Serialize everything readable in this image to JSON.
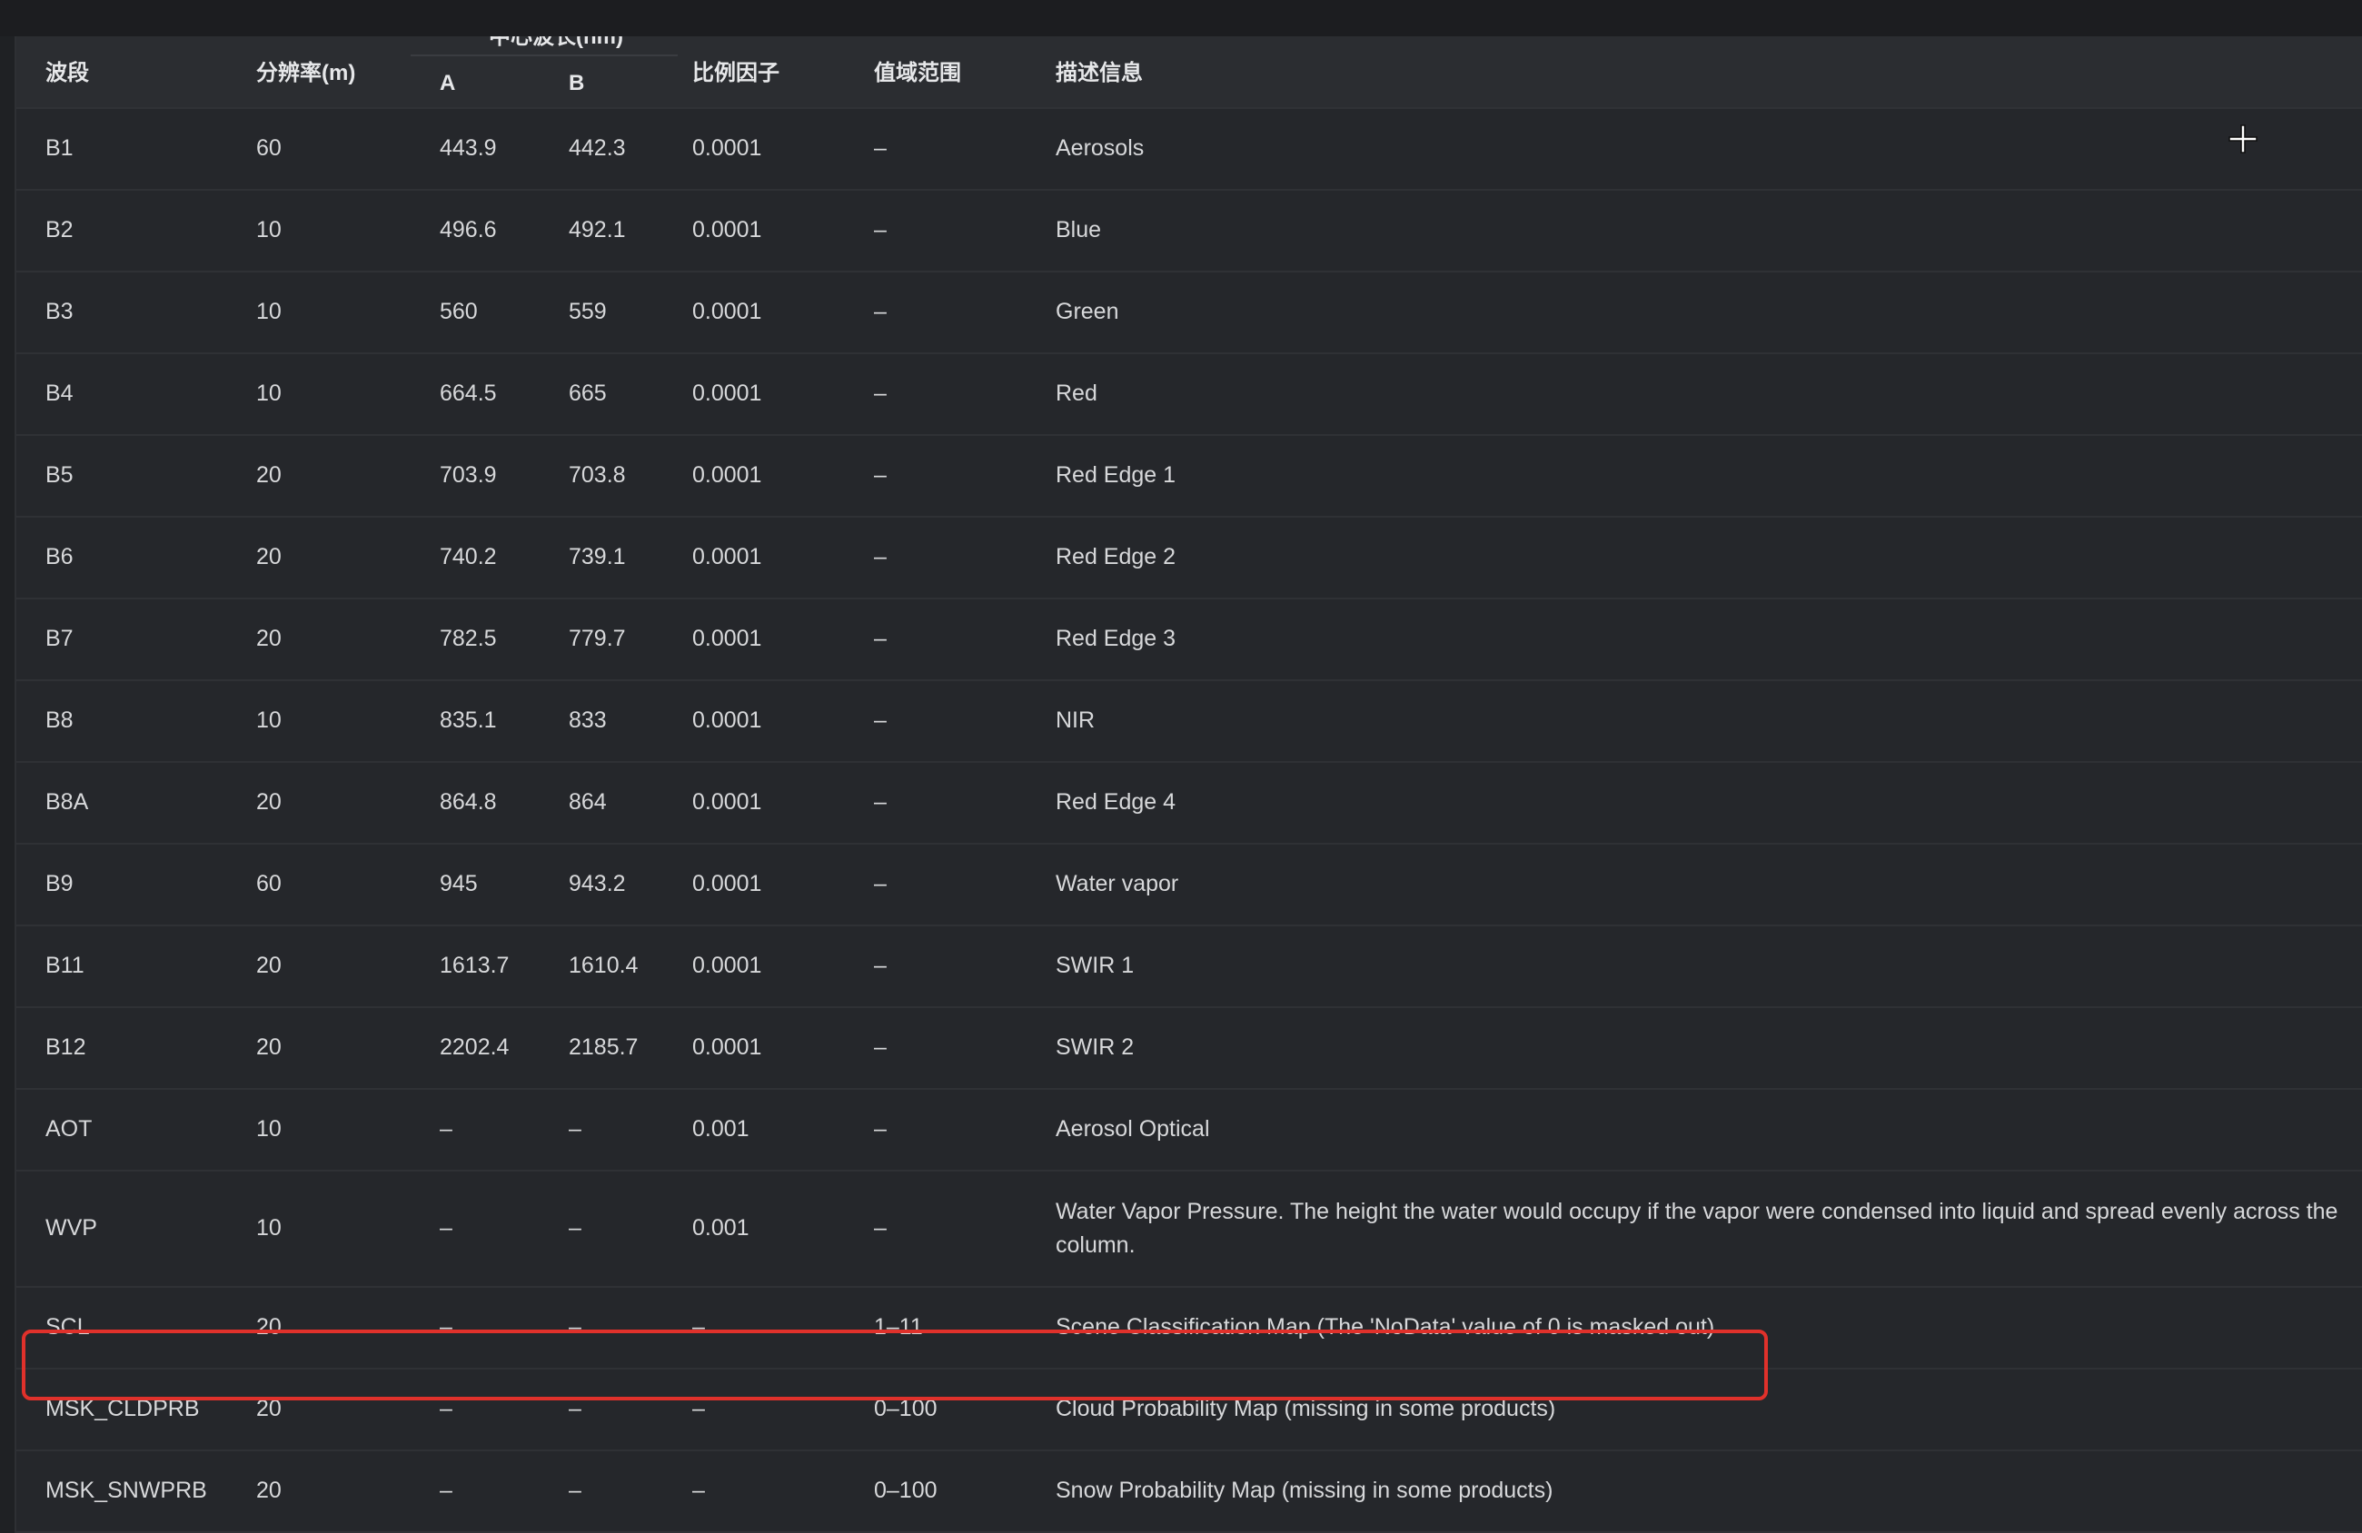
{
  "table": {
    "headers": {
      "band": "波段",
      "resolution": "分辨率(m)",
      "wavelength_group": "中心波长(nm)",
      "wavelength_a": "A",
      "wavelength_b": "B",
      "scale": "比例因子",
      "range": "值域范围",
      "description": "描述信息"
    },
    "rows": [
      {
        "band": "B1",
        "res": "60",
        "a": "443.9",
        "b": "442.3",
        "scale": "0.0001",
        "range": "–",
        "desc": "Aerosols"
      },
      {
        "band": "B2",
        "res": "10",
        "a": "496.6",
        "b": "492.1",
        "scale": "0.0001",
        "range": "–",
        "desc": "Blue"
      },
      {
        "band": "B3",
        "res": "10",
        "a": "560",
        "b": "559",
        "scale": "0.0001",
        "range": "–",
        "desc": "Green"
      },
      {
        "band": "B4",
        "res": "10",
        "a": "664.5",
        "b": "665",
        "scale": "0.0001",
        "range": "–",
        "desc": "Red"
      },
      {
        "band": "B5",
        "res": "20",
        "a": "703.9",
        "b": "703.8",
        "scale": "0.0001",
        "range": "–",
        "desc": "Red Edge 1"
      },
      {
        "band": "B6",
        "res": "20",
        "a": "740.2",
        "b": "739.1",
        "scale": "0.0001",
        "range": "–",
        "desc": "Red Edge 2"
      },
      {
        "band": "B7",
        "res": "20",
        "a": "782.5",
        "b": "779.7",
        "scale": "0.0001",
        "range": "–",
        "desc": "Red Edge 3"
      },
      {
        "band": "B8",
        "res": "10",
        "a": "835.1",
        "b": "833",
        "scale": "0.0001",
        "range": "–",
        "desc": "NIR"
      },
      {
        "band": "B8A",
        "res": "20",
        "a": "864.8",
        "b": "864",
        "scale": "0.0001",
        "range": "–",
        "desc": "Red Edge 4"
      },
      {
        "band": "B9",
        "res": "60",
        "a": "945",
        "b": "943.2",
        "scale": "0.0001",
        "range": "–",
        "desc": "Water vapor"
      },
      {
        "band": "B11",
        "res": "20",
        "a": "1613.7",
        "b": "1610.4",
        "scale": "0.0001",
        "range": "–",
        "desc": "SWIR 1"
      },
      {
        "band": "B12",
        "res": "20",
        "a": "2202.4",
        "b": "2185.7",
        "scale": "0.0001",
        "range": "–",
        "desc": "SWIR 2"
      },
      {
        "band": "AOT",
        "res": "10",
        "a": "–",
        "b": "–",
        "scale": "0.001",
        "range": "–",
        "desc": "Aerosol Optical"
      },
      {
        "band": "WVP",
        "res": "10",
        "a": "–",
        "b": "–",
        "scale": "0.001",
        "range": "–",
        "desc": "Water Vapor Pressure. The height the water would occupy if the vapor were condensed into liquid and spread evenly across the column."
      },
      {
        "band": "SCL",
        "res": "20",
        "a": "–",
        "b": "–",
        "scale": "–",
        "range": "1–11",
        "desc": "Scene Classification Map (The 'NoData' value of 0 is masked out)"
      },
      {
        "band": "MSK_CLDPRB",
        "res": "20",
        "a": "–",
        "b": "–",
        "scale": "–",
        "range": "0–100",
        "desc": "Cloud Probability Map (missing in some products)"
      },
      {
        "band": "MSK_SNWPRB",
        "res": "20",
        "a": "–",
        "b": "–",
        "scale": "–",
        "range": "0–100",
        "desc": "Snow Probability Map (missing in some products)"
      }
    ]
  },
  "highlight": {
    "row_band": "MSK_CLDPRB",
    "color": "#e0312b"
  },
  "cursor": {
    "icon": "crosshair-cursor-icon"
  }
}
